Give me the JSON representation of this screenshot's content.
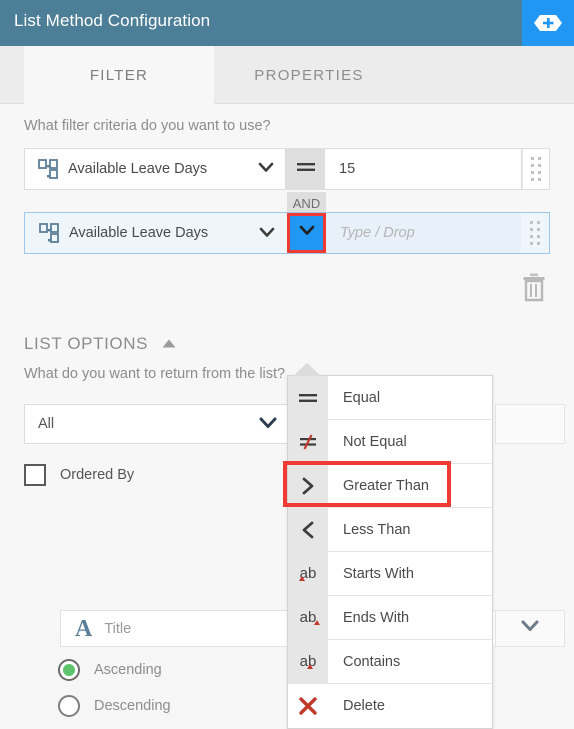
{
  "header": {
    "title": "List Method Configuration",
    "add_button_icon": "plus-icon",
    "bg_color": "#4d7e97",
    "add_button_color": "#2196f3"
  },
  "tabs": [
    {
      "label": "FILTER",
      "active": true
    },
    {
      "label": "PROPERTIES",
      "active": false
    }
  ],
  "filter": {
    "question": "What filter criteria do you want to use?",
    "conjunction": "AND",
    "rows": [
      {
        "field_icon": "number-field-icon",
        "field": "Available Leave Days",
        "operator_icon": "equal-icon",
        "operator": "Equal",
        "value": "15",
        "placeholder": "",
        "selected": false
      },
      {
        "field_icon": "number-field-icon",
        "field": "Available Leave Days",
        "operator_icon": "chevron-down-icon",
        "operator": "",
        "value": "",
        "placeholder": "Type / Drop",
        "selected": true
      }
    ],
    "delete_icon": "trash-icon"
  },
  "operator_menu": {
    "open": true,
    "highlight": "Greater Than",
    "highlight_color": "#ef3b34",
    "items": [
      {
        "icon": "equal-icon",
        "label": "Equal"
      },
      {
        "icon": "not-equal-icon",
        "label": "Not Equal"
      },
      {
        "icon": "greater-than-icon",
        "label": "Greater Than"
      },
      {
        "icon": "less-than-icon",
        "label": "Less Than"
      },
      {
        "icon": "starts-with-icon",
        "label": "Starts With"
      },
      {
        "icon": "ends-with-icon",
        "label": "Ends With"
      },
      {
        "icon": "contains-icon",
        "label": "Contains"
      },
      {
        "icon": "delete-x-icon",
        "label": "Delete"
      }
    ]
  },
  "list_options": {
    "section_title": "LIST OPTIONS",
    "collapse_icon": "triangle-up-icon",
    "question": "What do you want to return from the list?",
    "return_select": {
      "value": "All",
      "caret_icon": "chevron-down-icon"
    },
    "ordered_by": {
      "label": "Ordered By",
      "checked": false
    },
    "order_field": {
      "icon": "text-field-A-icon",
      "placeholder": "Title",
      "caret_icon": "chevron-down-icon"
    },
    "sort_options": [
      {
        "label": "Ascending",
        "selected": true,
        "color": "#5cc46a"
      },
      {
        "label": "Descending",
        "selected": false,
        "color": "#ffffff"
      }
    ]
  }
}
